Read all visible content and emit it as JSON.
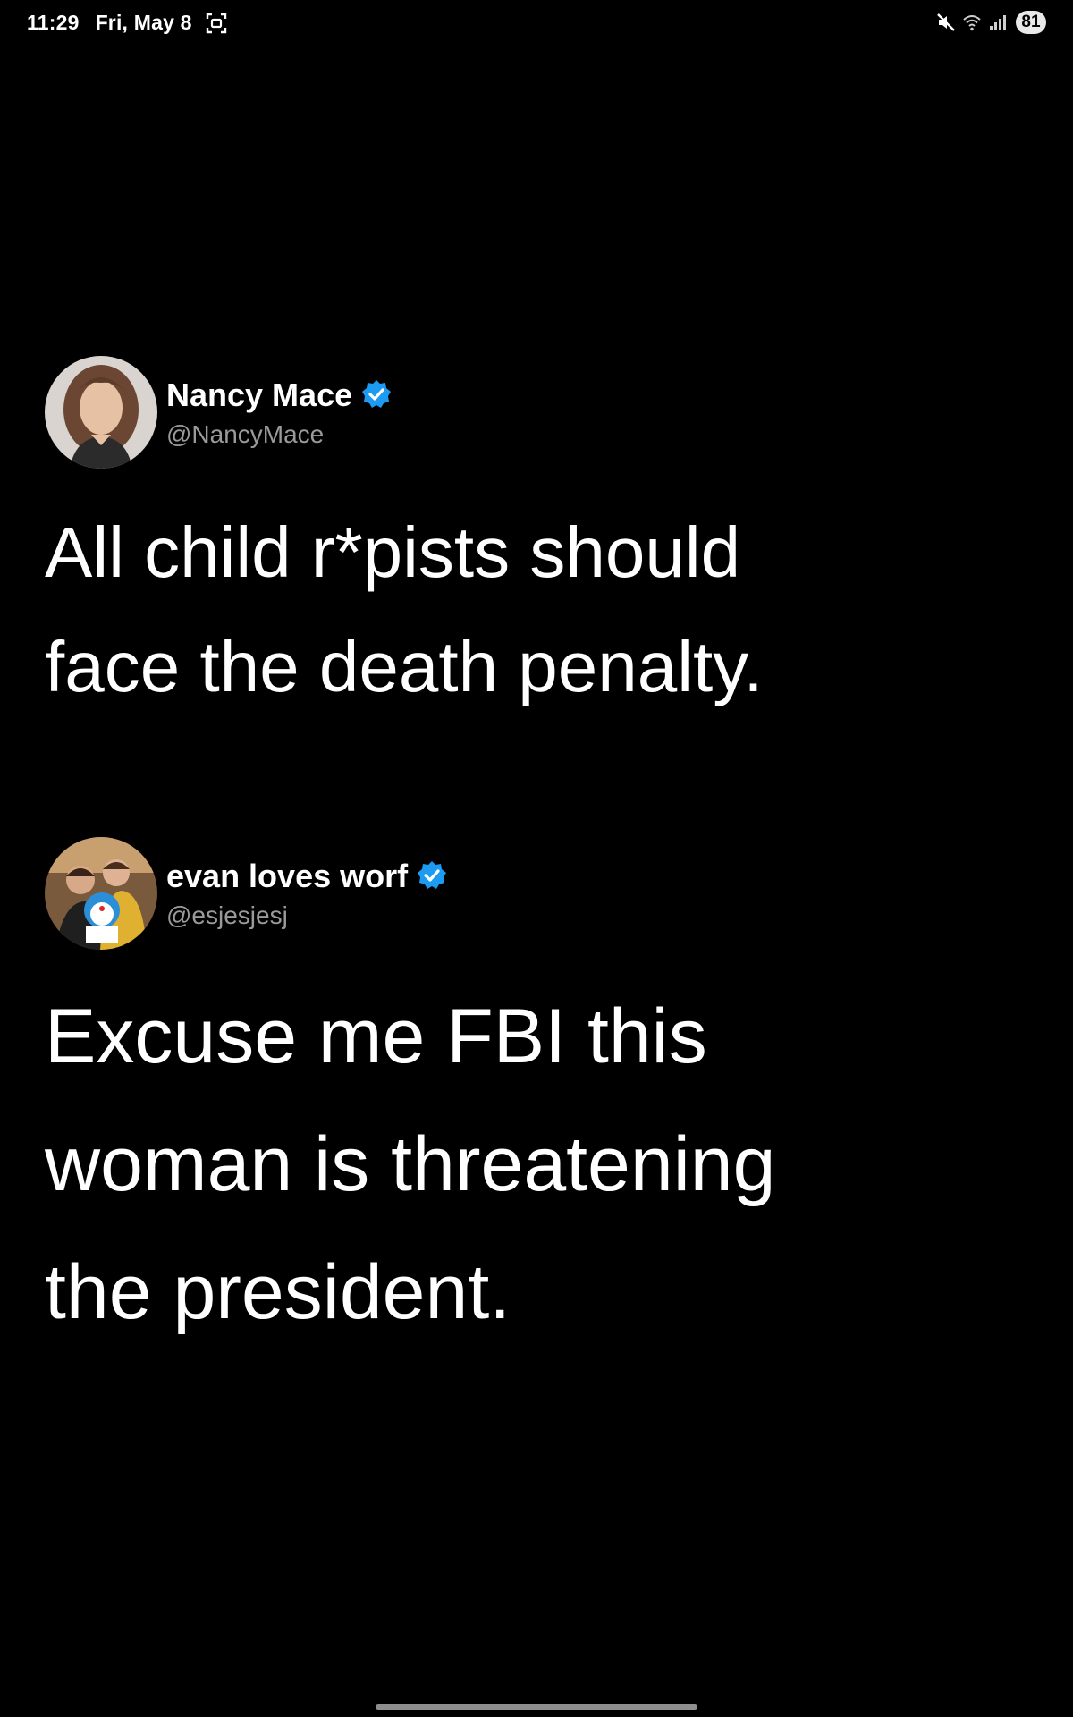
{
  "status_bar": {
    "time": "11:29",
    "date": "Fri, May 8",
    "battery": "81",
    "icons": [
      "screenshot-icon",
      "mute-icon",
      "wifi-icon",
      "signal-icon",
      "battery-icon"
    ]
  },
  "tweets": [
    {
      "display_name": "Nancy Mace",
      "handle": "@NancyMace",
      "verified": true,
      "text_lines": [
        "All child r*pists should",
        "face the death penalty."
      ]
    },
    {
      "display_name": "evan loves worf",
      "handle": "@esjesjesj",
      "verified": true,
      "text_lines": [
        "Excuse me FBI this",
        "woman is threatening",
        "the president."
      ]
    }
  ],
  "colors": {
    "background": "#000000",
    "text": "#ffffff",
    "handle": "#9a9a9a",
    "verified": "#1d9bf0",
    "home_indicator": "#8e8e8e"
  }
}
